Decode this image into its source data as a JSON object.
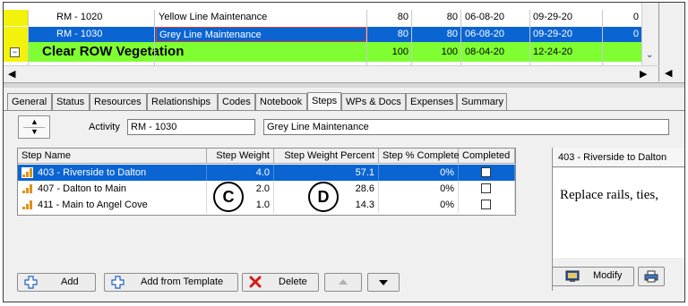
{
  "grid": {
    "rows": [
      {
        "id": "RM - 1020",
        "name": "Yellow Line Maintenance",
        "c1": "80",
        "c2": "80",
        "start": "06-08-20",
        "finish": "09-29-20",
        "last": "0"
      },
      {
        "id": "RM - 1030",
        "name": "Grey Line Maintenance",
        "c1": "80",
        "c2": "80",
        "start": "06-08-20",
        "finish": "09-29-20",
        "last": "0"
      }
    ],
    "group": {
      "expander": "−",
      "title": "Clear ROW Vegetation",
      "c1": "100",
      "c2": "100",
      "start": "08-04-20",
      "finish": "12-24-20"
    }
  },
  "tabs": [
    "General",
    "Status",
    "Resources",
    "Relationships",
    "Codes",
    "Notebook",
    "Steps",
    "WPs & Docs",
    "Expenses",
    "Summary"
  ],
  "active_tab": "Steps",
  "activity": {
    "label": "Activity",
    "id": "RM - 1030",
    "name": "Grey Line Maintenance"
  },
  "steps_table": {
    "headers": [
      "Step Name",
      "Step Weight",
      "Step Weight Percent",
      "Step % Complete",
      "Completed"
    ],
    "rows": [
      {
        "name": "403 - Riverside to Dalton",
        "weight": "4.0",
        "percent": "57.1",
        "complete": "0%",
        "completed": false
      },
      {
        "name": "407 - Dalton to Main",
        "weight": "2.0",
        "percent": "28.6",
        "complete": "0%",
        "completed": false
      },
      {
        "name": "411 - Main to Angel Cove",
        "weight": "1.0",
        "percent": "14.3",
        "complete": "0%",
        "completed": false
      }
    ]
  },
  "callouts": {
    "c": "C",
    "d": "D"
  },
  "buttons": {
    "add": "Add",
    "add_template": "Add from Template",
    "delete": "Delete"
  },
  "description": {
    "header": "403 - Riverside to Dalton",
    "text": "Replace rails, ties,",
    "modify": "Modify"
  },
  "colors": {
    "selection": "#0a64d2",
    "group_row": "#7fff32",
    "indicator": "#f2f20a"
  }
}
